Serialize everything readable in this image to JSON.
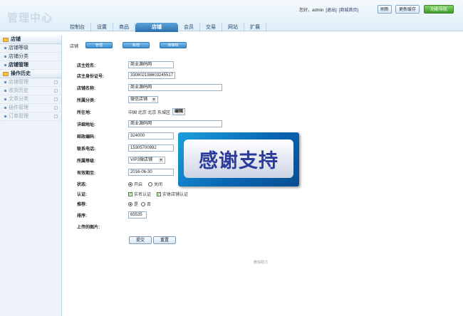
{
  "header": {
    "logo_text": "管理中心",
    "greeting": "您好，admin",
    "logout": "[退出]",
    "home_link": "[商城首页]",
    "refresh_button": "刷新",
    "cache_button": "更新缓存",
    "help_button": "功能导航"
  },
  "nav": {
    "tabs": [
      {
        "label": "控制台"
      },
      {
        "label": "设置"
      },
      {
        "label": "商品"
      },
      {
        "label": "店铺"
      },
      {
        "label": "会员"
      },
      {
        "label": "交易"
      },
      {
        "label": "网站"
      },
      {
        "label": "扩展"
      }
    ]
  },
  "sidebar": {
    "section1": "店铺",
    "items1": [
      "店铺等级",
      "店铺分类",
      "店铺管理"
    ],
    "section2": "操作历史",
    "items2": [
      "店铺管理",
      "收货历史",
      "文章分类",
      "插件管理",
      "订单管理"
    ]
  },
  "content": {
    "crumb": "店铺",
    "tabs": [
      "管理",
      "新增",
      "待审核"
    ],
    "fields": {
      "owner_label": "店主姓名:",
      "owner_value": "商业源码网",
      "idcard_label": "店主身份证号:",
      "idcard_value": "330802198603245517",
      "store_label": "店铺名称:",
      "store_value": "商业源码网",
      "category_label": "所属分类:",
      "category_value": "微信店铺",
      "region_label": "所在地:",
      "region_value": "中国 北京 北京 东城区",
      "region_edit": "编辑",
      "address_label": "详细地址:",
      "address_value": "商业源码网",
      "zip_label": "邮政编码:",
      "zip_value": "324000",
      "phone_label": "联系电话:",
      "phone_value": "15305700992",
      "grade_label": "所属等级:",
      "grade_value": "VIP3微店铺",
      "expire_label": "有效期至:",
      "expire_value": "2016-06-30",
      "status_label": "状态:",
      "status_on": "开启",
      "status_off": "关闭",
      "cert_label": "认证:",
      "cert_a": "实名认证",
      "cert_b": "实体店铺认证",
      "recommend_label": "推荐:",
      "recommend_yes": "是",
      "recommend_no": "否",
      "sort_label": "排序:",
      "sort_value": "65535",
      "image_label": "上传的图片:"
    },
    "submit_button": "提交",
    "reset_button": "重置",
    "footer": "微信助力"
  },
  "overlay": {
    "text": "感谢支持"
  }
}
